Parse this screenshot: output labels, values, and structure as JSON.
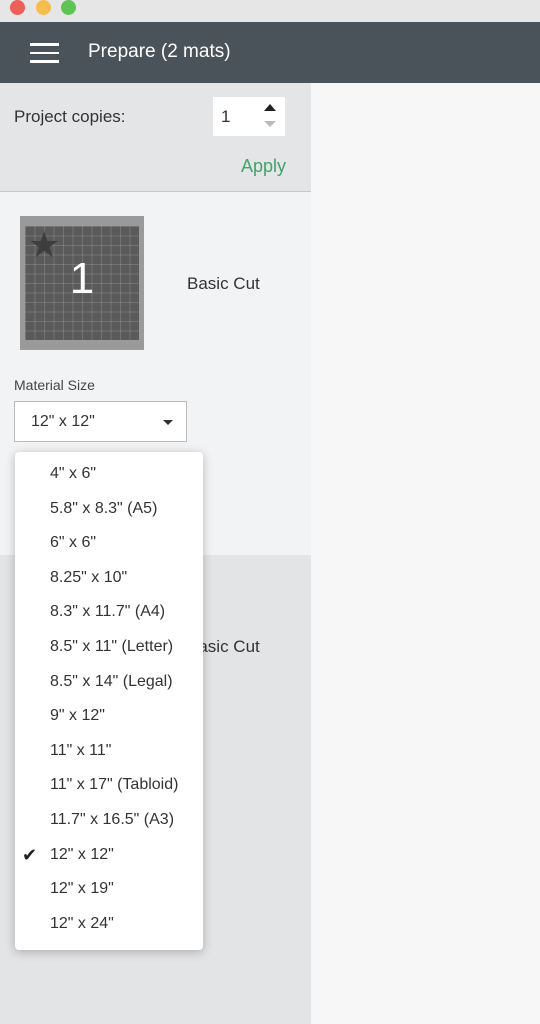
{
  "window": {
    "controls": [
      {
        "name": "close",
        "color": "#ee5f58"
      },
      {
        "name": "minimize",
        "color": "#f5bd4f"
      },
      {
        "name": "maximize",
        "color": "#5fc454"
      }
    ]
  },
  "header": {
    "title": "Prepare (2 mats)",
    "menu_icon": "hamburger-icon"
  },
  "copies": {
    "label": "Project copies:",
    "value": "1",
    "apply": "Apply",
    "accent": "#3fa36b"
  },
  "mats": [
    {
      "number": "1",
      "type": "Basic Cut",
      "material_size_label": "Material Size",
      "material_size": "12\" x 12\""
    },
    {
      "type": "Basic Cut"
    }
  ],
  "dropdown": {
    "selected": "12\" x 12\"",
    "options": [
      "4\" x 6\"",
      "5.8\" x 8.3\" (A5)",
      "6\" x 6\"",
      "8.25\" x 10\"",
      "8.3\" x 11.7\" (A4)",
      "8.5\" x 11\" (Letter)",
      "8.5\" x 14\" (Legal)",
      "9\" x 12\"",
      "11\" x 11\"",
      "11\" x 17\" (Tabloid)",
      "11.7\" x 16.5\" (A3)",
      "12\" x 12\"",
      "12\" x 19\"",
      "12\" x 24\""
    ]
  }
}
